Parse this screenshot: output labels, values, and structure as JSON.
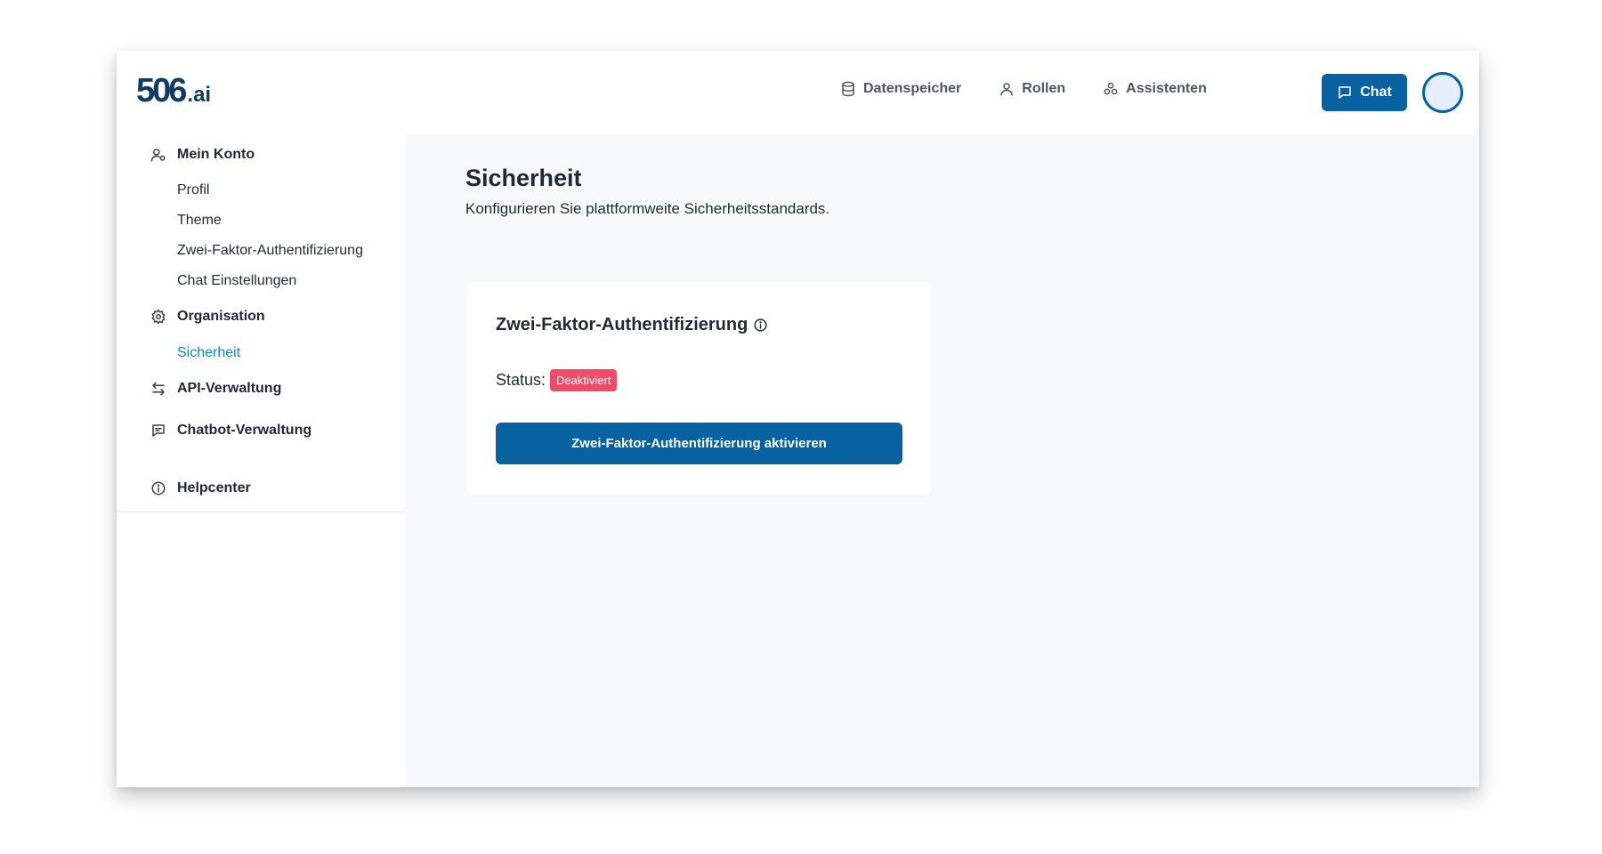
{
  "app": {
    "logo_main": "506",
    "logo_suffix": ".ai"
  },
  "header": {
    "nav": [
      {
        "label": "Datenspeicher",
        "icon": "database-icon"
      },
      {
        "label": "Rollen",
        "icon": "user-icon"
      },
      {
        "label": "Assistenten",
        "icon": "assistants-icon"
      }
    ],
    "chat_label": "Chat",
    "chat_icon": "chat-bubble-icon"
  },
  "sidebar": {
    "sections": [
      {
        "label": "Mein Konto",
        "icon": "user-settings-icon",
        "items": [
          "Profil",
          "Theme",
          "Zwei-Faktor-Authentifizierung",
          "Chat Einstellungen"
        ]
      },
      {
        "label": "Organisation",
        "icon": "gear-icon",
        "items": [
          "Sicherheit"
        ]
      },
      {
        "label": "API-Verwaltung",
        "icon": "arrows-exchange-icon",
        "items": []
      },
      {
        "label": "Chatbot-Verwaltung",
        "icon": "message-square-icon",
        "items": []
      }
    ],
    "help": {
      "label": "Helpcenter",
      "icon": "info-icon"
    },
    "active_item": "Sicherheit"
  },
  "main": {
    "title": "Sicherheit",
    "subtitle": "Konfigurieren Sie plattformweite Sicherheitsstandards.",
    "card": {
      "title": "Zwei-Faktor-Authentifizierung",
      "status_label": "Status:",
      "status_value": "Deaktiviert",
      "button_label": "Zwei-Faktor-Authentifizierung aktivieren"
    }
  },
  "colors": {
    "primary": "#0861a0",
    "active_link": "#0a84c6",
    "badge_danger": "#f04b68",
    "logo": "#103b64",
    "main_bg": "#f8f9fb"
  }
}
